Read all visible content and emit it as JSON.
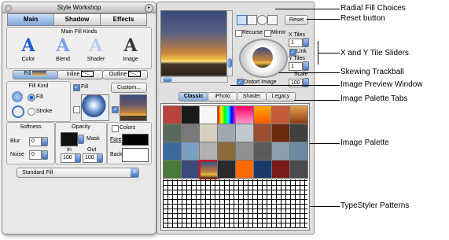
{
  "window": {
    "title": "Style Workshop"
  },
  "tabs": [
    "Main",
    "Shadow",
    "Effects"
  ],
  "fill_kinds": {
    "header": "Main Fill Kinds",
    "items": [
      {
        "glyph": "A",
        "label": "Color"
      },
      {
        "glyph": "A",
        "label": "Blend"
      },
      {
        "glyph": "A",
        "label": "Shader"
      },
      {
        "glyph": "A",
        "label": "Image"
      }
    ]
  },
  "fill_tabs": [
    "Fill",
    "Inline",
    "Outline"
  ],
  "fill_kind": {
    "header": "Fill Kind",
    "fill": "Fill",
    "stroke": "Stroke"
  },
  "fill_checkbox": "Fill",
  "custom_button": "Custom...",
  "softness": {
    "header": "Softness",
    "blur_label": "Blur",
    "blur_value": "0",
    "noise_label": "Noise",
    "noise_value": "0"
  },
  "opacity": {
    "header": "Opacity",
    "mask_label": "Mask",
    "in_label": "In",
    "in_value": "100",
    "out_label": "Out",
    "out_value": "100"
  },
  "colors": {
    "header": "Colors",
    "fore_label": "Fore",
    "back_label": "Back"
  },
  "fill_type": "Standard Fill",
  "toolbar": {
    "reset_label": "Reset"
  },
  "options": {
    "recurse": "Recurse",
    "mirror": "Mirror",
    "x_tiles_label": "X Tiles",
    "x_tiles_value": "1",
    "link": "Link",
    "y_tiles_label": "Y Tiles",
    "y_tiles_value": "1",
    "distort": "Distort Image",
    "scale_label": "Scale",
    "scale_value": "100"
  },
  "palette_tabs": [
    "Classic",
    "iPhoto",
    "Shader",
    "Legacy"
  ],
  "annotations": [
    "Radial Fill Choices",
    "Reset button",
    "X and Y Tile Sliders",
    "Skewing Trackball",
    "Image Preview Window",
    "Image Palette Tabs",
    "Image Palette",
    "TypeStyler Patterns"
  ],
  "colors_palette": {
    "sunset_top": "#3a4a7a",
    "sunset_mid": "#c8843c",
    "sunset_low": "#f2c04a",
    "tab_selected": "#7fa7d9",
    "accent_blue": "#3f74c9"
  }
}
